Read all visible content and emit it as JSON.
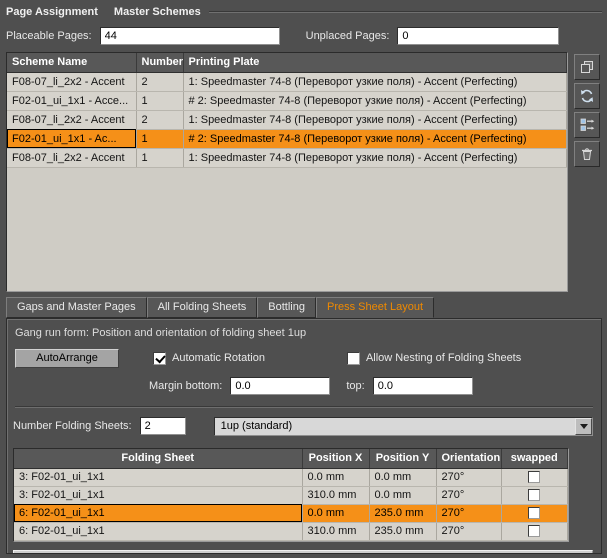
{
  "colors": {
    "accent_orange": "#F59018",
    "tab_active_text": "#F08A00"
  },
  "header": {
    "section_page_assignment": "Page Assignment",
    "section_master_schemes": "Master Schemes",
    "placeable_label": "Placeable Pages:",
    "placeable_value": "44",
    "unplaced_label": "Unplaced Pages:",
    "unplaced_value": "0"
  },
  "schemes_table": {
    "columns": {
      "name": "Scheme Name",
      "number": "Number",
      "plate": "Printing Plate"
    },
    "rows": [
      {
        "name": "F08-07_li_2x2 - Accent",
        "number": "2",
        "plate": "1: Speedmaster 74-8 (Переворот узкие поля) - Accent (Perfecting)",
        "selected": false
      },
      {
        "name": "F02-01_ui_1x1 - Acce...",
        "number": "1",
        "plate": "# 2: Speedmaster 74-8 (Переворот узкие поля) - Accent (Perfecting)",
        "selected": false
      },
      {
        "name": "F08-07_li_2x2 - Accent",
        "number": "2",
        "plate": "1: Speedmaster 74-8 (Переворот узкие поля) - Accent (Perfecting)",
        "selected": false
      },
      {
        "name": "F02-01_ui_1x1 - Ac...",
        "number": "1",
        "plate": "# 2: Speedmaster 74-8 (Переворот узкие поля) - Accent (Perfecting)",
        "selected": true
      },
      {
        "name": "F08-07_li_2x2 - Accent",
        "number": "1",
        "plate": "1: Speedmaster 74-8 (Переворот узкие поля) - Accent (Perfecting)",
        "selected": false
      }
    ]
  },
  "side_toolbar": {
    "buttons": [
      {
        "name": "duplicate"
      },
      {
        "name": "refresh"
      },
      {
        "name": "assign"
      },
      {
        "name": "delete"
      }
    ]
  },
  "tabs": [
    {
      "label": "Gaps and Master Pages",
      "active": false
    },
    {
      "label": "All Folding Sheets",
      "active": false
    },
    {
      "label": "Bottling",
      "active": false
    },
    {
      "label": "Press Sheet Layout",
      "active": true
    }
  ],
  "press_sheet_layout": {
    "description": "Gang run form: Position and orientation of folding sheet 1up",
    "autoarrange_label": "AutoArrange",
    "automatic_rotation_label": "Automatic Rotation",
    "automatic_rotation_checked": true,
    "allow_nesting_label": "Allow Nesting of Folding Sheets",
    "allow_nesting_checked": false,
    "margin_bottom_label": "Margin bottom:",
    "margin_bottom_value": "0.0",
    "margin_top_label": "top:",
    "margin_top_value": "0.0",
    "number_folding_sheets_label": "Number Folding Sheets:",
    "number_folding_sheets_value": "2",
    "folding_type_value": "1up (standard)"
  },
  "folding_table": {
    "columns": {
      "sheet": "Folding Sheet",
      "x": "Position X",
      "y": "Position Y",
      "orientation": "Orientation",
      "swapped": "swapped"
    },
    "rows": [
      {
        "sheet": "3: F02-01_ui_1x1",
        "x": "0.0 mm",
        "y": "0.0 mm",
        "orientation": "270°",
        "swapped": false,
        "selected": false
      },
      {
        "sheet": "3: F02-01_ui_1x1",
        "x": "310.0 mm",
        "y": "0.0 mm",
        "orientation": "270°",
        "swapped": false,
        "selected": false
      },
      {
        "sheet": "6: F02-01_ui_1x1",
        "x": "0.0 mm",
        "y": "235.0 mm",
        "orientation": "270°",
        "swapped": false,
        "selected": true
      },
      {
        "sheet": "6: F02-01_ui_1x1",
        "x": "310.0 mm",
        "y": "235.0 mm",
        "orientation": "270°",
        "swapped": false,
        "selected": false
      }
    ]
  }
}
